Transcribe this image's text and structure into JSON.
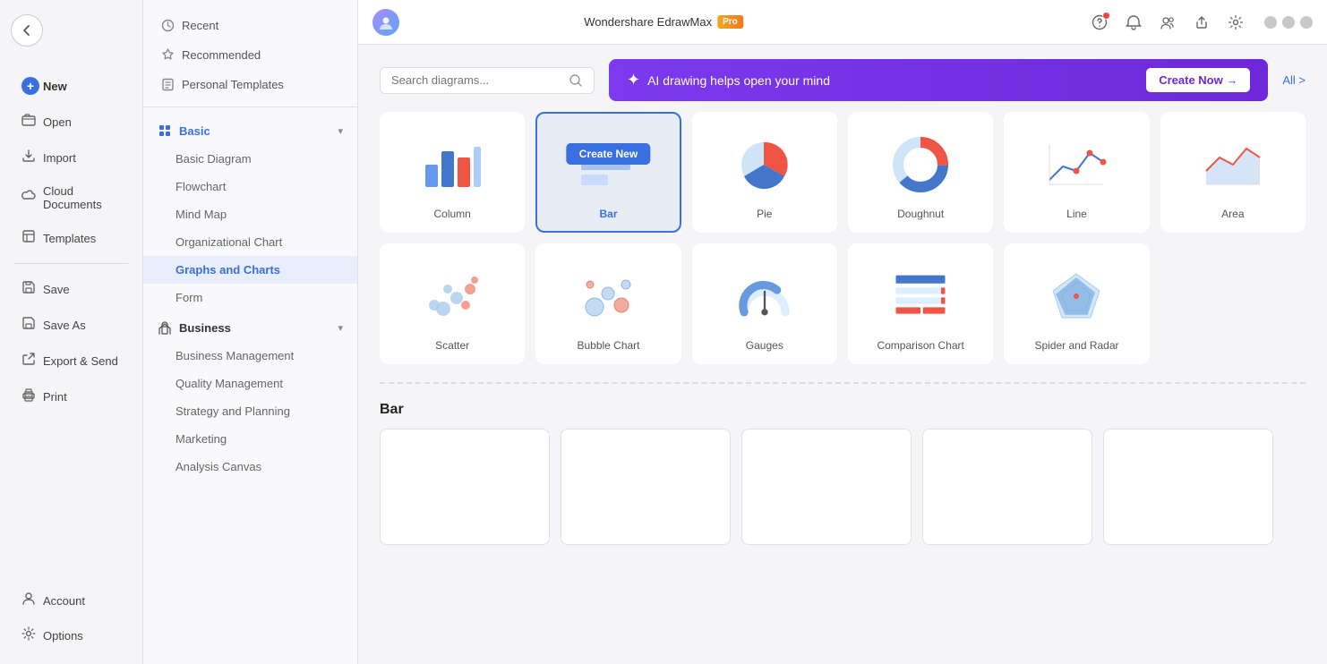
{
  "app": {
    "title": "Wondershare EdrawMax",
    "badge": "Pro"
  },
  "topbar": {
    "search_placeholder": "Search diagrams...",
    "ai_banner_text": "AI drawing helps open your mind",
    "create_now_label": "Create Now →",
    "all_label": "All >"
  },
  "left_sidebar": {
    "back_button": "←",
    "nav_items": [
      {
        "id": "new",
        "label": "New",
        "icon": "➕"
      },
      {
        "id": "open",
        "label": "Open",
        "icon": "📂"
      },
      {
        "id": "import",
        "label": "Import",
        "icon": "📥"
      },
      {
        "id": "cloud",
        "label": "Cloud Documents",
        "icon": "☁️"
      },
      {
        "id": "templates",
        "label": "Templates",
        "icon": "📋"
      },
      {
        "id": "save",
        "label": "Save",
        "icon": "💾"
      },
      {
        "id": "saveas",
        "label": "Save As",
        "icon": "💾"
      },
      {
        "id": "export",
        "label": "Export & Send",
        "icon": "📤"
      },
      {
        "id": "print",
        "label": "Print",
        "icon": "🖨️"
      }
    ],
    "bottom_items": [
      {
        "id": "account",
        "label": "Account",
        "icon": "👤"
      },
      {
        "id": "options",
        "label": "Options",
        "icon": "⚙️"
      }
    ]
  },
  "secondary_sidebar": {
    "top_items": [
      {
        "id": "recent",
        "label": "Recent",
        "icon": "🕐"
      },
      {
        "id": "recommended",
        "label": "Recommended",
        "icon": "⭐"
      },
      {
        "id": "personal",
        "label": "Personal Templates",
        "icon": "📄"
      }
    ],
    "sections": [
      {
        "id": "basic",
        "label": "Basic",
        "icon": "🔷",
        "expanded": true,
        "sub_items": [
          {
            "id": "basic-diagram",
            "label": "Basic Diagram"
          },
          {
            "id": "flowchart",
            "label": "Flowchart"
          },
          {
            "id": "mind-map",
            "label": "Mind Map"
          },
          {
            "id": "org-chart",
            "label": "Organizational Chart"
          },
          {
            "id": "graphs-charts",
            "label": "Graphs and Charts",
            "active": true
          },
          {
            "id": "form",
            "label": "Form"
          }
        ]
      },
      {
        "id": "business",
        "label": "Business",
        "icon": "💼",
        "expanded": true,
        "sub_items": [
          {
            "id": "business-mgmt",
            "label": "Business Management"
          },
          {
            "id": "quality-mgmt",
            "label": "Quality Management"
          },
          {
            "id": "strategy",
            "label": "Strategy and Planning"
          },
          {
            "id": "marketing",
            "label": "Marketing"
          },
          {
            "id": "analysis-canvas",
            "label": "Analysis Canvas"
          }
        ]
      }
    ]
  },
  "grid": {
    "charts": [
      {
        "id": "column",
        "label": "Column",
        "selected": false
      },
      {
        "id": "bar",
        "label": "Bar",
        "selected": true,
        "create_new": true
      },
      {
        "id": "pie",
        "label": "Pie",
        "selected": false
      },
      {
        "id": "doughnut",
        "label": "Doughnut",
        "selected": false
      },
      {
        "id": "line",
        "label": "Line",
        "selected": false
      },
      {
        "id": "area",
        "label": "Area",
        "selected": false
      },
      {
        "id": "scatter",
        "label": "Scatter",
        "selected": false
      },
      {
        "id": "bubble",
        "label": "Bubble Chart",
        "selected": false
      },
      {
        "id": "gauges",
        "label": "Gauges",
        "selected": false
      },
      {
        "id": "comparison",
        "label": "Comparison Chart",
        "selected": false
      },
      {
        "id": "spider",
        "label": "Spider and Radar",
        "selected": false
      }
    ],
    "create_new_label": "Create New",
    "section_title": "Bar"
  }
}
